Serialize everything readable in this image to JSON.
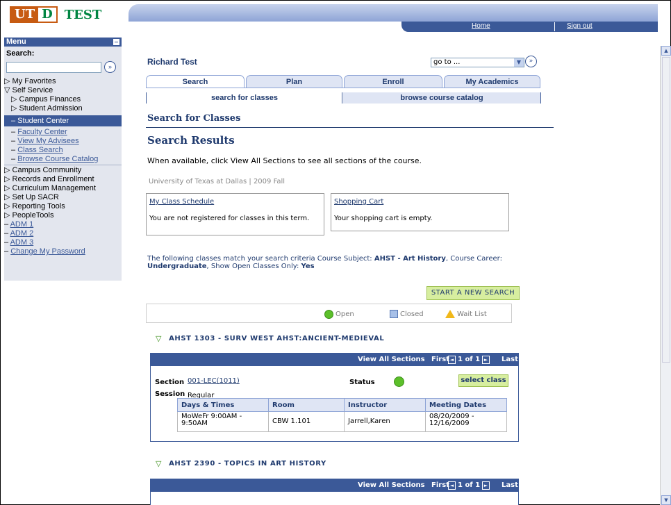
{
  "logo": {
    "part1": "UT",
    "part2": "D",
    "suffix": "TEST"
  },
  "topnav": {
    "home": "Home",
    "signout": "Sign out"
  },
  "menu": {
    "title": "Menu",
    "search_label": "Search:",
    "search_value": "",
    "items": [
      {
        "label": "▷ My Favorites"
      },
      {
        "label": "▽ Self Service"
      },
      {
        "label": "▷ Campus Finances"
      },
      {
        "label": "▷ Student Admission"
      },
      {
        "label": "– Student Center"
      },
      {
        "label": "Faculty Center"
      },
      {
        "label": "View My Advisees"
      },
      {
        "label": "Class Search"
      },
      {
        "label": "Browse Course Catalog"
      },
      {
        "label": "Campus Community"
      },
      {
        "label": "Records and Enrollment"
      },
      {
        "label": "Curriculum Management"
      },
      {
        "label": "Set Up SACR"
      },
      {
        "label": "Reporting Tools"
      },
      {
        "label": "PeopleTools"
      },
      {
        "label": "ADM 1"
      },
      {
        "label": "ADM 2"
      },
      {
        "label": "ADM 3"
      },
      {
        "label": "Change My Password"
      }
    ]
  },
  "header": {
    "user_name": "Richard Test",
    "goto_value": "go to ..."
  },
  "tabs": [
    "Search",
    "Plan",
    "Enroll",
    "My Academics"
  ],
  "subtabs": [
    "search for classes",
    "browse course catalog"
  ],
  "main": {
    "title": "Search for Classes",
    "subtitle": "Search Results",
    "info": "When available, click View All Sections to see all sections of the course.",
    "term": "University of Texas at Dallas | 2009 Fall",
    "schedule_link": "My Class Schedule",
    "schedule_text": "You are not registered for classes in this term.",
    "cart_link": "Shopping Cart",
    "cart_text": "Your shopping cart is empty.",
    "criteria_prefix": "The following classes match your search criteria Course Subject:",
    "criteria_subject": "AHST - Art History",
    "criteria_career_label": "Course Career:",
    "criteria_career": "Undergraduate",
    "criteria_open_label": "Show Open Classes Only:",
    "criteria_open": "Yes",
    "new_search": "START A NEW SEARCH",
    "legend": {
      "open": "Open",
      "closed": "Closed",
      "waitlist": "Wait List"
    }
  },
  "courses": [
    {
      "title": "AHST 1303 - SURV WEST AHST:ANCIENT-MEDIEVAL",
      "view_all": "View All Sections",
      "nav_first": "First",
      "nav_count": "1 of 1",
      "nav_last": "Last",
      "section_label": "Section",
      "section": "001-LEC(1011)",
      "status_label": "Status",
      "select": "select class",
      "session_label": "Session",
      "session": "Regular",
      "headers": [
        "Days & Times",
        "Room",
        "Instructor",
        "Meeting Dates"
      ],
      "row": [
        "MoWeFr 9:00AM - 9:50AM",
        "CBW 1.101",
        "Jarrell,Karen",
        "08/20/2009 - 12/16/2009"
      ]
    },
    {
      "title": "AHST 2390 - TOPICS IN ART HISTORY",
      "view_all": "View All Sections",
      "nav_first": "First",
      "nav_count": "1 of 1",
      "nav_last": "Last"
    }
  ],
  "colors": {
    "brand_orange": "#c75b12",
    "brand_green": "#008542",
    "nav_blue": "#3b5998",
    "button_green": "#d7ee9f"
  }
}
